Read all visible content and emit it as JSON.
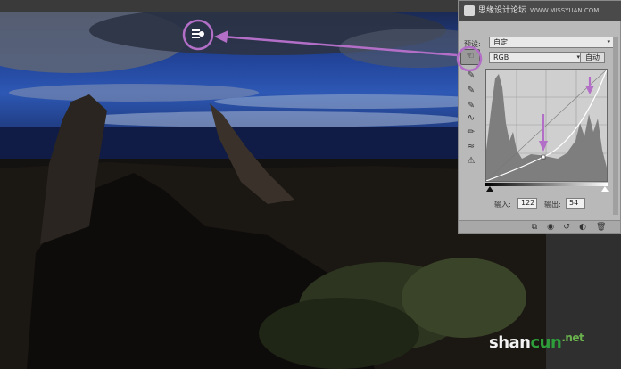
{
  "watermark": {
    "site_cn": "思缘设计论坛",
    "site_url": "WWW.MISSYUAN.COM"
  },
  "curves_panel": {
    "preset_label": "预设:",
    "preset_value": "自定",
    "channel_value": "RGB",
    "auto_button": "自动",
    "input_label": "输入:",
    "input_value": "122",
    "output_label": "输出:",
    "output_value": "54"
  },
  "logo": {
    "text_a": "shan",
    "text_b": "cun",
    "text_c": ".net"
  },
  "colors": {
    "annotation": "#b36fc7",
    "panel_bg": "#b9b9b9"
  },
  "icons": {
    "tools": [
      "target-adjust-icon",
      "eyedropper-black-icon",
      "eyedropper-gray-icon",
      "eyedropper-white-icon",
      "curve-point-icon",
      "pencil-icon",
      "smooth-icon",
      "histogram-warning-icon"
    ],
    "footer": [
      "clip-layer-icon",
      "visibility-icon",
      "reset-icon",
      "toggle-icon",
      "trash-icon"
    ]
  }
}
